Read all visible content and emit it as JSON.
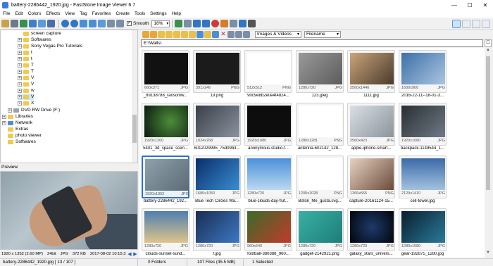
{
  "window": {
    "title": "battery-2286442_1920.jpg - FastStone Image Viewer 6.7"
  },
  "menu": [
    "File",
    "Edit",
    "Colors",
    "Effects",
    "View",
    "Tag",
    "Favorites",
    "Create",
    "Tools",
    "Settings",
    "Help"
  ],
  "toolbar": {
    "smooth_label": "Smooth",
    "smooth_checked": "✓",
    "zoom": "16%"
  },
  "tree": {
    "items": [
      "screen capture",
      "Softwares",
      "Sony Vegas Pro Tutorials",
      "t",
      "t",
      "T",
      "T",
      "V",
      "V",
      "w",
      "V",
      "X",
      "DVD RW Drive (F:)",
      "Libraries",
      "Network",
      "Extras",
      "photo viewer",
      "Softwares"
    ]
  },
  "preview": {
    "label": "Preview",
    "info": {
      "dimensions": "1920 x 1352 (2.60 MP)",
      "bit": "24bit",
      "format": "JPG",
      "size": "372 KB",
      "date": "2017-08-02 10:15:3"
    }
  },
  "browser": {
    "filter": "Images & Videos",
    "sort": "Filename",
    "path": "E:\\Walls\\",
    "thumbs": [
      {
        "res": "660x371",
        "fmt": "JPG",
        "name": "_89138788_ransomw..."
      },
      {
        "res": "391x146",
        "fmt": "PNG",
        "name": "19.png"
      },
      {
        "res": "512x512",
        "fmt": "PNG",
        "name": "90c9e8b2e0e4f4824..."
      },
      {
        "res": "1280x720",
        "fmt": "JPG",
        "name": "123.jpeg"
      },
      {
        "res": "2560x1440",
        "fmt": "JPG",
        "name": "1111.jpg"
      },
      {
        "res": "1600x900",
        "fmt": "JPG",
        "name": "2016-22-11--18-01-3..."
      },
      {
        "res": "1920x1200",
        "fmt": "JPG",
        "name": "5401_3d_space_scen..."
      },
      {
        "res": "1024x768",
        "fmt": "JPG",
        "name": "6012029995_75d09b3..."
      },
      {
        "res": "1920x1080",
        "fmt": "JPG",
        "name": "anonymous-studio-f..."
      },
      {
        "res": "1280x1281",
        "fmt": "PNG",
        "name": "antenna-602142_128..."
      },
      {
        "res": "2560x423",
        "fmt": "JPG",
        "name": "apple-iphone-smart..."
      },
      {
        "res": "1920x1080",
        "fmt": "JPG",
        "name": "backpack-1149544_1..."
      },
      {
        "res": "1920x1352",
        "fmt": "JPG",
        "name": "battery-2286442_192..."
      },
      {
        "res": "1680x1050",
        "fmt": "JPG",
        "name": "Blue Tech Circles Wa..."
      },
      {
        "res": "1280x720",
        "fmt": "JPG",
        "name": "blue-clouds-day-fluf..."
      },
      {
        "res": "1200x1028",
        "fmt": "PNG",
        "name": "Botón_Me_gusta.svg..."
      },
      {
        "res": "1366x565",
        "fmt": "PNG",
        "name": "capture-20161124-15..."
      },
      {
        "res": "2129x1410",
        "fmt": "JPG",
        "name": "cell-tower.jpg"
      },
      {
        "res": "1280x720",
        "fmt": "JPG",
        "name": "clouds-sunset-sund..."
      },
      {
        "res": "1280x720",
        "fmt": "JPG",
        "name": "f.jpg"
      },
      {
        "res": "960x640",
        "fmt": "JPG",
        "name": "football-380388_960..."
      },
      {
        "res": "1280x720",
        "fmt": "JPG",
        "name": "gadget-2142921.png"
      },
      {
        "res": "1280x720",
        "fmt": "JPG",
        "name": "galaxy_stars_univers..."
      },
      {
        "res": "1280x1080",
        "fmt": "JPG",
        "name": "gear-192875_1280.jpg"
      }
    ]
  },
  "status": {
    "file": "battery-2286442_1920.jpg [ 13 / 107 ]",
    "folders": "0 Folders",
    "files": "107 Files (45.5 MB)",
    "selected": "1 Selected"
  }
}
